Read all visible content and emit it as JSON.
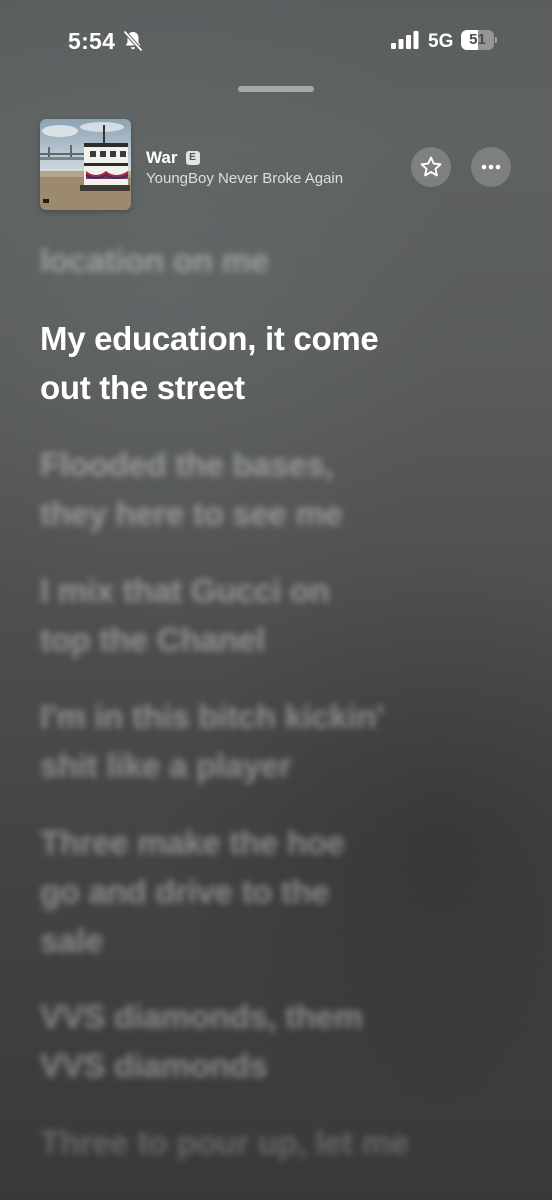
{
  "status_bar": {
    "time": "5:54",
    "network": "5G",
    "battery_level": "51",
    "battery_fraction": 0.51,
    "bell_icon": "bell-slash-icon",
    "signal_icon": "signal-bars-icon"
  },
  "track": {
    "title": "War",
    "explicit_badge": "E",
    "artist": "YoungBoy Never Broke Again",
    "artwork_icon": "album-artwork"
  },
  "actions": {
    "favorite_icon": "star-icon",
    "more_icon": "ellipsis-icon"
  },
  "lyrics": {
    "lines": [
      {
        "text": "location on me",
        "state": "past"
      },
      {
        "text": "My education, it come\nout the street",
        "state": "current"
      },
      {
        "text": "Flooded the bases,\nthey here to see me",
        "state": "upcoming"
      },
      {
        "text": "I mix that Gucci on\ntop the Chanel",
        "state": "upcoming"
      },
      {
        "text": "I'm in this bitch kickin'\nshit like a player",
        "state": "upcoming"
      },
      {
        "text": "Three make the hoe\ngo and drive to the\nsale",
        "state": "upcoming"
      },
      {
        "text": "VVS diamonds, them\nVVS diamonds",
        "state": "upcoming"
      },
      {
        "text": "Three to pour up, let me",
        "state": "upcoming"
      }
    ]
  },
  "colors": {
    "background_top": "#5b5e5f",
    "background_bottom": "#3a3937",
    "active_lyric": "#ffffff"
  }
}
